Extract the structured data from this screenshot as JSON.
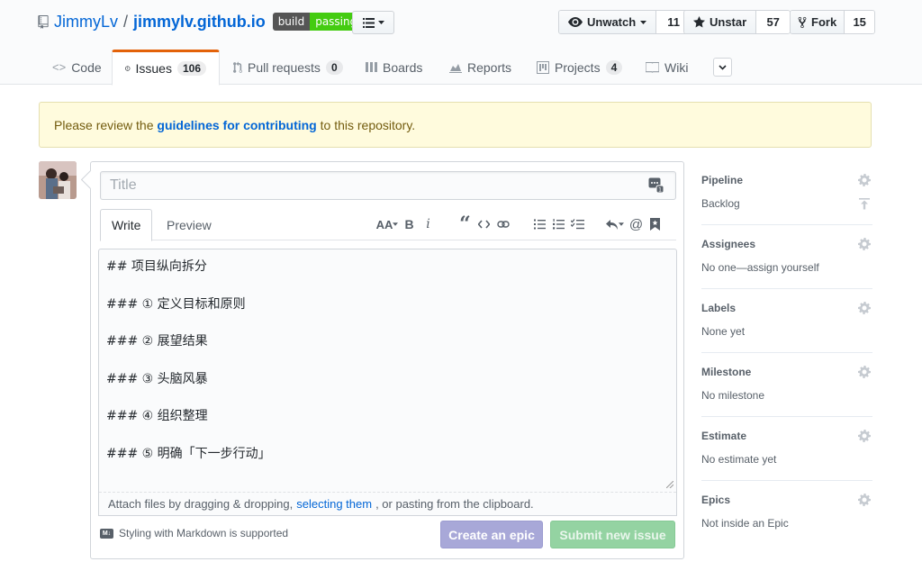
{
  "repo": {
    "owner": "JimmyLv",
    "separator": "/",
    "name": "jimmylv.github.io",
    "badge_left": "build",
    "badge_right": "passing"
  },
  "actions": {
    "watch_label": "Unwatch",
    "watch_count": "11",
    "star_label": "Unstar",
    "star_count": "57",
    "fork_label": "Fork",
    "fork_count": "15"
  },
  "tabs": [
    {
      "label": "Code"
    },
    {
      "label": "Issues",
      "count": "106"
    },
    {
      "label": "Pull requests",
      "count": "0"
    },
    {
      "label": "Boards"
    },
    {
      "label": "Reports"
    },
    {
      "label": "Projects",
      "count": "4"
    },
    {
      "label": "Wiki"
    }
  ],
  "flash": {
    "before": "Please review the",
    "link": "guidelines for contributing",
    "after": "to this repository."
  },
  "form": {
    "title_placeholder": "Title",
    "write_tab": "Write",
    "preview_tab": "Preview",
    "toolbar": {
      "header": "AA",
      "bold": "B",
      "italic": "i",
      "quote": "“",
      "mention": "@"
    },
    "body": "## 项目纵向拆分\n\n### ① 定义目标和原则\n\n### ② 展望结果\n\n### ③ 头脑风暴\n\n### ④ 组织整理\n\n### ⑤ 明确「下一步行动」",
    "attach_before": "Attach files by dragging & dropping,",
    "attach_link": "selecting them",
    "attach_after": ", or pasting from the clipboard.",
    "markdown_note": "Styling with Markdown is supported",
    "markdown_icon_label": "M↓",
    "create_epic_label": "Create an epic",
    "submit_label": "Submit new issue"
  },
  "sidebar": [
    {
      "label": "Pipeline",
      "value": "Backlog"
    },
    {
      "label": "Assignees",
      "value": "No one—assign yourself"
    },
    {
      "label": "Labels",
      "value": "None yet"
    },
    {
      "label": "Milestone",
      "value": "No milestone"
    },
    {
      "label": "Estimate",
      "value": "No estimate yet"
    },
    {
      "label": "Epics",
      "value": "Not inside an Epic"
    }
  ],
  "colors": {
    "link": "#0366d6",
    "issues_tab_accent": "#e36209",
    "epic_button": "#a8a8d8",
    "submit_button": "#94d3a2",
    "badge_passing": "#44cc11",
    "flash_bg": "#fffbdd"
  }
}
